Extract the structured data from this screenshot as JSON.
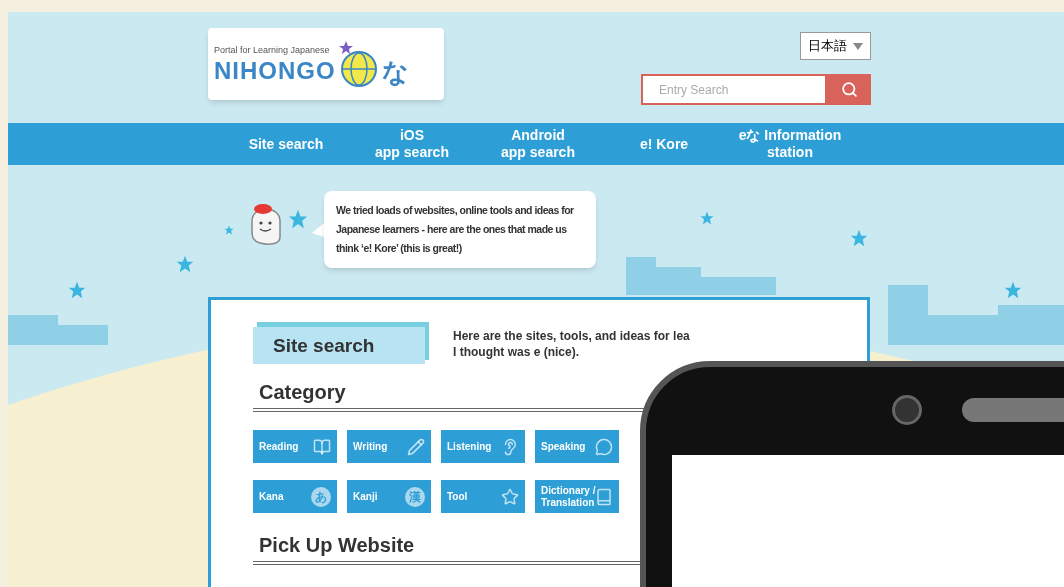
{
  "header": {
    "logo": {
      "tagline": "Portal for Learning Japanese",
      "wordmark": "NIHONGO",
      "kana": "な"
    },
    "language": "日本語",
    "search": {
      "placeholder": "Entry Search"
    }
  },
  "nav": [
    {
      "label": "Site search"
    },
    {
      "label": "iOS\napp search"
    },
    {
      "label": "Android\napp search"
    },
    {
      "label": "e! Kore"
    },
    {
      "label": "eな Information\nstation"
    }
  ],
  "bubble": "We tried loads of websites, online tools and ideas for Japanese learners - here are the ones that made us think ‘e! Kore’ (this is great!)",
  "main": {
    "title": "Site search",
    "intro": "Here are the sites, tools, and ideas for lea",
    "intro_line_2": "I thought was e (nice).",
    "category_heading": "Category",
    "categories": [
      {
        "label": "Reading",
        "kind": "icon"
      },
      {
        "label": "Writing",
        "kind": "icon"
      },
      {
        "label": "Listening",
        "kind": "icon"
      },
      {
        "label": "Speaking",
        "kind": "icon"
      },
      {
        "label": "Kana",
        "kind": "glyph",
        "glyph": "あ"
      },
      {
        "label": "Kanji",
        "kind": "glyph",
        "glyph": "漢"
      },
      {
        "label": "Tool",
        "kind": "icon"
      },
      {
        "label": "Dictionary /\nTranslation",
        "kind": "icon"
      }
    ],
    "pickup_heading": "Pick Up Website"
  }
}
